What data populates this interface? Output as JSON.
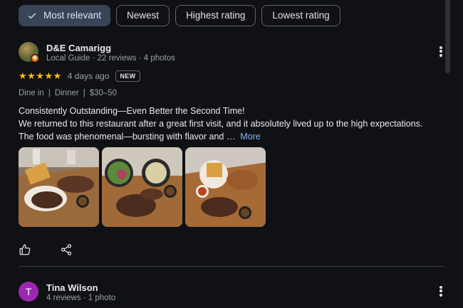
{
  "filters": {
    "chips": [
      {
        "label": "Most relevant",
        "selected": true
      },
      {
        "label": "Newest",
        "selected": false
      },
      {
        "label": "Highest rating",
        "selected": false
      },
      {
        "label": "Lowest rating",
        "selected": false
      }
    ]
  },
  "reviews": [
    {
      "author": "D&E Camarigg",
      "meta": "Local Guide · 22 reviews · 4 photos",
      "rating": 5,
      "stars": "★★★★★",
      "time_ago": "4 days ago",
      "badge": "NEW",
      "tags": [
        "Dine in",
        "Dinner",
        "$30–50"
      ],
      "text_lines": [
        "Consistently Outstanding—Even Better the Second Time!",
        "We returned to this restaurant after a great first visit, and it absolutely lived up to the high expectations.",
        "The food was phenomenal—bursting with flavor and …"
      ],
      "more_label": "More",
      "photo_count": 3
    },
    {
      "author": "Tina Wilson",
      "avatar_letter": "T",
      "meta": "4 reviews · 1 photo"
    }
  ],
  "icons": {
    "check": "check-icon",
    "more": "more-vert-icon",
    "like": "thumb-up-icon",
    "share": "share-icon"
  },
  "colors": {
    "background": "#101114",
    "selected_chip": "#394457",
    "star": "#fbbc04",
    "link": "#8ab4f8",
    "avatar_tina": "#9c27b0"
  }
}
